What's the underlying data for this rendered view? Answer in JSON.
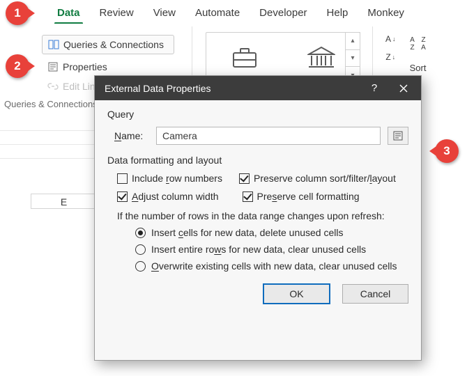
{
  "tabs": {
    "data": "Data",
    "review": "Review",
    "view": "View",
    "automate": "Automate",
    "developer": "Developer",
    "help": "Help",
    "monkey": "Monkey "
  },
  "pane": {
    "queries_connections": "Queries & Connections",
    "properties": "Properties",
    "edit_links": "Edit Links",
    "group_label": "Queries & Connections",
    "sort_label": "Sort",
    "az_asc": "A↓Z",
    "az_desc": "Z↓A"
  },
  "sheet": {
    "col_e": "E"
  },
  "callouts": {
    "one": "1",
    "two": "2",
    "three": "3"
  },
  "dialog": {
    "title": "External Data Properties",
    "help": "?",
    "query": "Query",
    "name_label": "Name:",
    "name_value": "Camera",
    "section": "Data formatting and layout",
    "include_row_numbers": "Include row numbers",
    "preserve_layout": "Preserve column sort/filter/layout",
    "adjust_width": "Adjust column width",
    "preserve_fmt": "Preserve cell formatting",
    "refresh_note": "If the number of rows in the data range changes upon refresh:",
    "r1": "Insert cells for new data, delete unused cells",
    "r2": "Insert entire rows for new data, clear unused cells",
    "r3": "Overwrite existing cells with new data, clear unused cells",
    "ok": "OK",
    "cancel": "Cancel"
  }
}
